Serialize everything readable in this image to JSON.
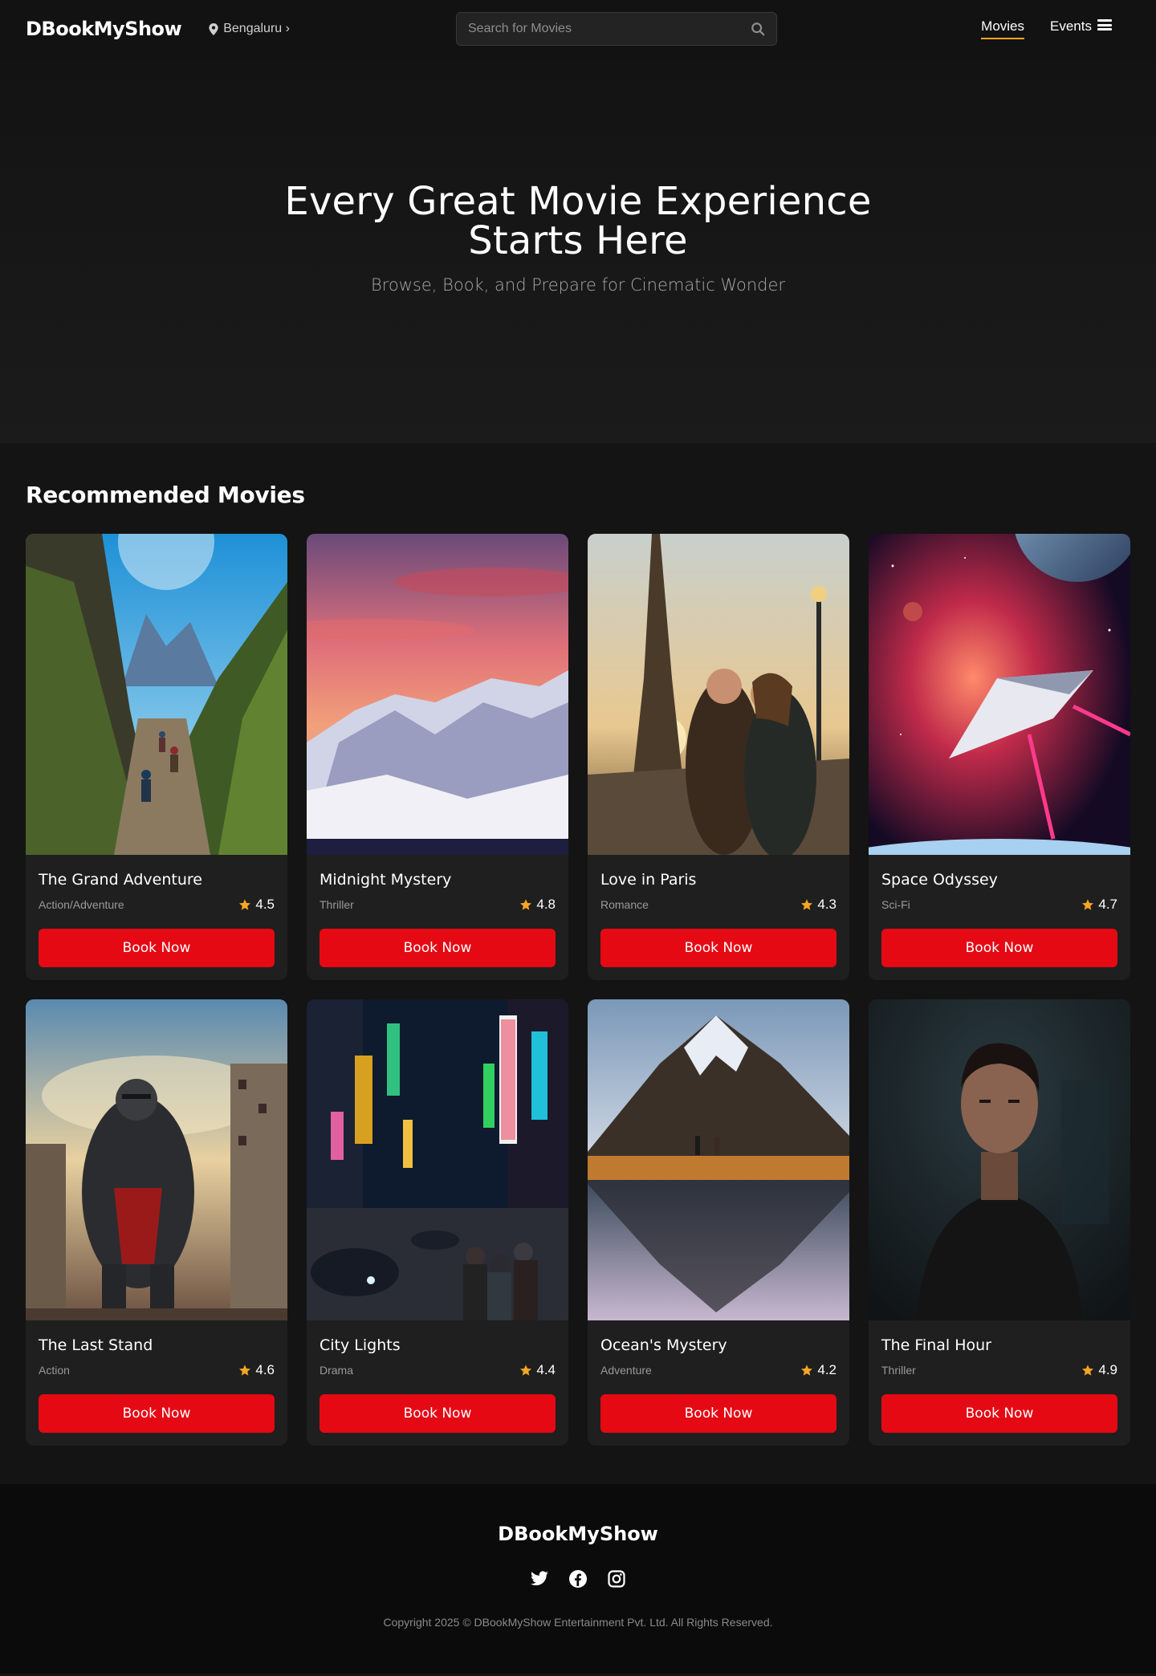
{
  "header": {
    "logo": "DBookMyShow",
    "location": "Bengaluru ›",
    "search_placeholder": "Search for Movies",
    "nav": [
      {
        "label": "Movies",
        "active": true
      },
      {
        "label": "Events",
        "active": false
      }
    ]
  },
  "hero": {
    "title": "Every Great Movie Experience Starts Here",
    "subtitle": "Browse, Book, and Prepare for Cinematic Wonder"
  },
  "section": {
    "title": "Recommended Movies"
  },
  "movies": [
    {
      "title": "The Grand Adventure",
      "genre": "Action/Adventure",
      "rating": "4.5",
      "button": "Book Now"
    },
    {
      "title": "Midnight Mystery",
      "genre": "Thriller",
      "rating": "4.8",
      "button": "Book Now"
    },
    {
      "title": "Love in Paris",
      "genre": "Romance",
      "rating": "4.3",
      "button": "Book Now"
    },
    {
      "title": "Space Odyssey",
      "genre": "Sci-Fi",
      "rating": "4.7",
      "button": "Book Now"
    },
    {
      "title": "The Last Stand",
      "genre": "Action",
      "rating": "4.6",
      "button": "Book Now"
    },
    {
      "title": "City Lights",
      "genre": "Drama",
      "rating": "4.4",
      "button": "Book Now"
    },
    {
      "title": "Ocean's Mystery",
      "genre": "Adventure",
      "rating": "4.2",
      "button": "Book Now"
    },
    {
      "title": "The Final Hour",
      "genre": "Thriller",
      "rating": "4.9",
      "button": "Book Now"
    }
  ],
  "footer": {
    "logo": "DBookMyShow",
    "socials": [
      "twitter-icon",
      "facebook-icon",
      "instagram-icon"
    ],
    "copyright": "Copyright 2025 © DBookMyShow Entertainment Pvt. Ltd. All Rights Reserved."
  },
  "colors": {
    "background": "#141414",
    "card": "#1f1f1f",
    "accent": "#e50914",
    "star": "#f5a623",
    "nav_underline": "#f5a623"
  }
}
